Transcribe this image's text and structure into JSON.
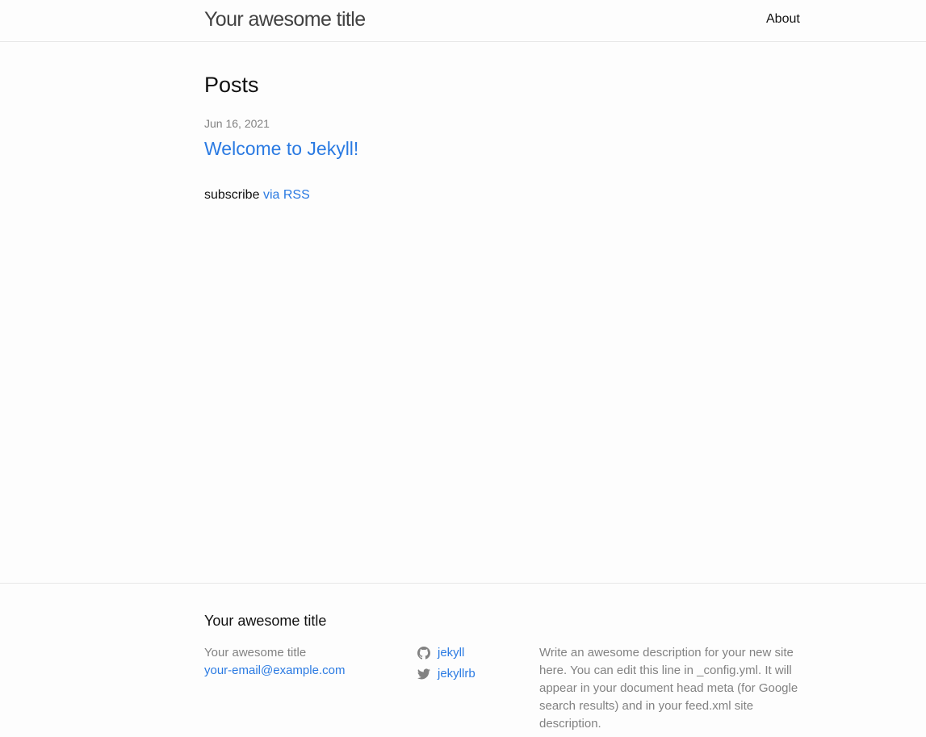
{
  "header": {
    "site_title": "Your awesome title",
    "nav": [
      {
        "label": "About"
      }
    ]
  },
  "main": {
    "heading": "Posts",
    "posts": [
      {
        "date": "Jun 16, 2021",
        "title": "Welcome to Jekyll!"
      }
    ],
    "rss_prefix": "subscribe",
    "rss_link": "via RSS"
  },
  "footer": {
    "heading": "Your awesome title",
    "name": "Your awesome title",
    "email": "your-email@example.com",
    "social": [
      {
        "icon": "github-icon",
        "label": "jekyll"
      },
      {
        "icon": "twitter-icon",
        "label": "jekyllrb"
      }
    ],
    "description": "Write an awesome description for your new site here. You can edit this line in _config.yml. It will appear in your document head meta (for Google search results) and in your feed.xml site description."
  },
  "colors": {
    "link": "#2a7ae2",
    "muted": "#828282",
    "text": "#111111",
    "background": "#fdfdfd",
    "border": "#e8e8e8"
  }
}
